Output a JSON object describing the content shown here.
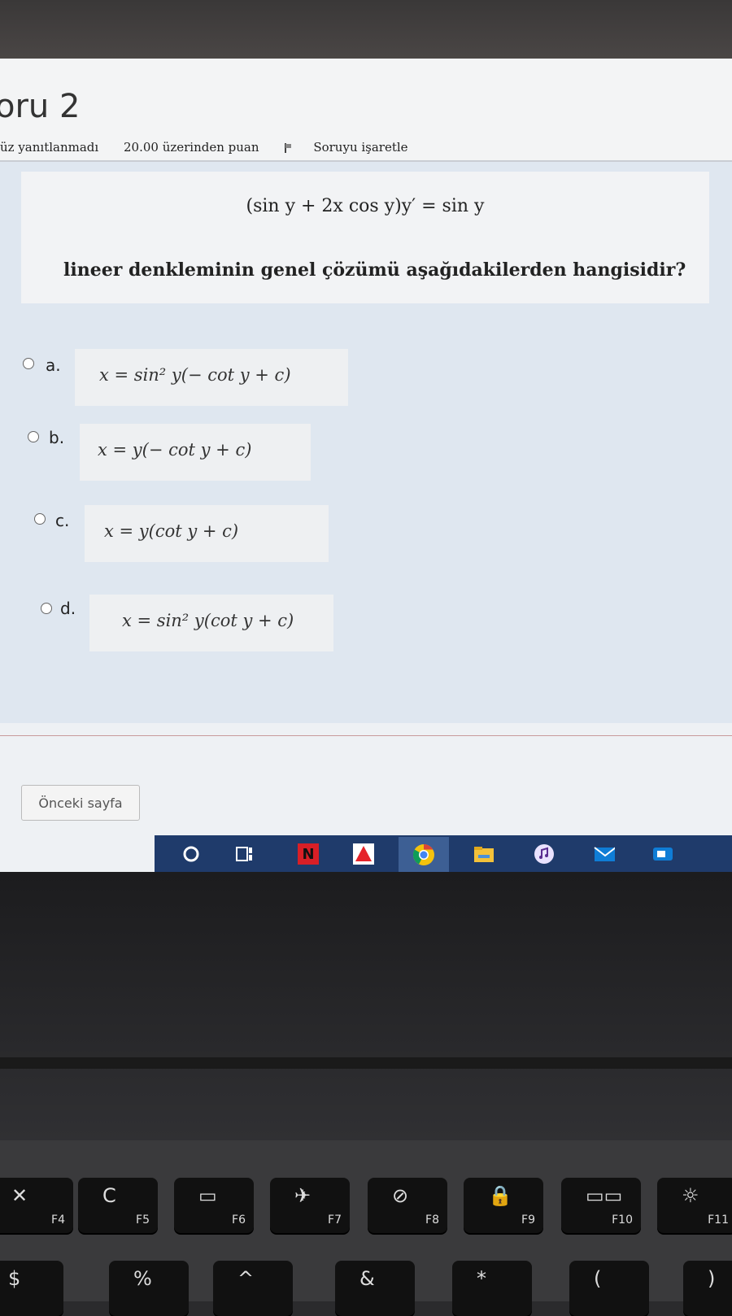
{
  "quiz": {
    "title": "oru 2",
    "status": "üz yanıtlanmadı",
    "points": "20.00 üzerinden puan",
    "flag_label": "Soruyu işaretle"
  },
  "question": {
    "equation": "(sin y + 2x cos y)y′ = sin y",
    "text": "lineer denkleminin genel çözümü aşağıdakilerden hangisidir?"
  },
  "options": [
    {
      "letter": "a.",
      "formula": "x = sin² y(− cot y + c)"
    },
    {
      "letter": "b.",
      "formula": "x = y(− cot y + c)"
    },
    {
      "letter": "c.",
      "formula": "x = y(cot y + c)"
    },
    {
      "letter": "d.",
      "formula": "x = sin² y(cot y + c)"
    }
  ],
  "navigation": {
    "prev_label": "Önceki sayfa"
  },
  "taskbar": {
    "icons": [
      "cortana-icon",
      "task-view-icon",
      "netflix-icon",
      "acrobat-icon",
      "chrome-icon",
      "file-explorer-icon",
      "groove-music-icon",
      "mail-icon",
      "camera-icon"
    ],
    "netflix_letter": "N"
  },
  "keyboard": {
    "keys": [
      {
        "symbol": "✕",
        "fn": "F4"
      },
      {
        "symbol": "C",
        "fn": "F5"
      },
      {
        "symbol": "▭",
        "fn": "F6"
      },
      {
        "symbol": "✈",
        "fn": "F7"
      },
      {
        "symbol": "⊘",
        "fn": "F8"
      },
      {
        "symbol": "🔒",
        "fn": "F9"
      },
      {
        "symbol": "▭▭",
        "fn": "F10"
      },
      {
        "symbol": "☼",
        "fn": "F11"
      }
    ],
    "number_row": [
      "$",
      "%",
      "^",
      "&",
      "*",
      "(",
      ")"
    ]
  }
}
